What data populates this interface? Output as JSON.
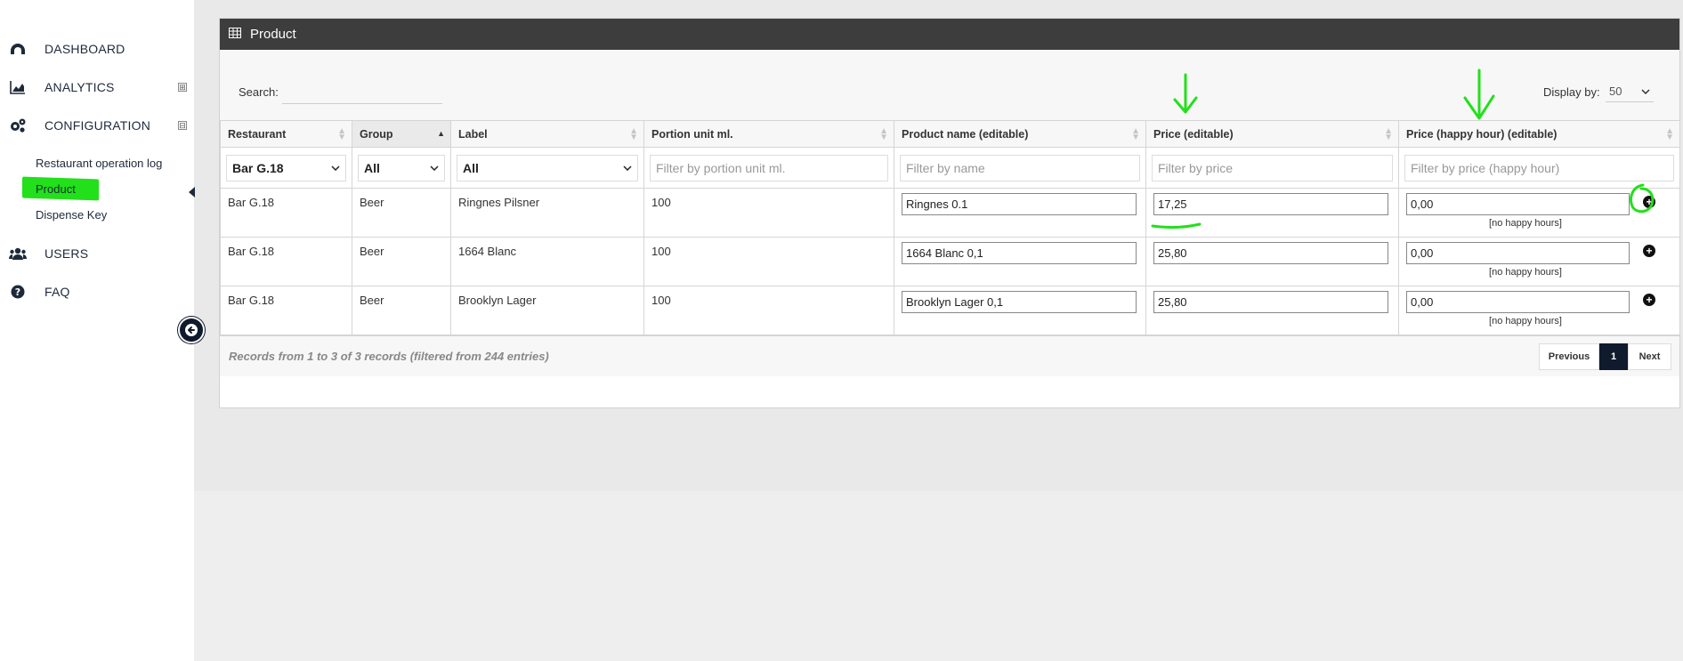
{
  "sidebar": {
    "items": [
      {
        "label": "DASHBOARD",
        "icon": "dashboard-icon"
      },
      {
        "label": "ANALYTICS",
        "icon": "area-chart-icon",
        "toggle": "⊞"
      },
      {
        "label": "CONFIGURATION",
        "icon": "cogs-icon",
        "toggle": "⊟"
      },
      {
        "label": "USERS",
        "icon": "users-icon"
      },
      {
        "label": "FAQ",
        "icon": "question-circle-icon"
      }
    ],
    "subitems": [
      "Restaurant operation log",
      "Product",
      "Dispense Key"
    ],
    "highlight_color": "#22e01a"
  },
  "panel": {
    "title": "Product",
    "search_label": "Search:",
    "display_label": "Display by:",
    "display_value": "50"
  },
  "table": {
    "columns": [
      "Restaurant",
      "Group",
      "Label",
      "Portion unit ml.",
      "Product name (editable)",
      "Price (editable)",
      "Price (happy hour) (editable)"
    ],
    "filters": {
      "restaurant": "Bar G.18",
      "group": "All",
      "label": "All",
      "portion_placeholder": "Filter by portion unit ml.",
      "name_placeholder": "Filter by name",
      "price_placeholder": "Filter by price",
      "hh_placeholder": "Filter by price (happy hour)"
    },
    "rows": [
      {
        "restaurant": "Bar G.18",
        "group": "Beer",
        "label": "Ringnes Pilsner",
        "portion": "100",
        "name": "Ringnes 0.1",
        "price": "17,25",
        "hh_price": "0,00",
        "hh_note": "[no happy hours]"
      },
      {
        "restaurant": "Bar G.18",
        "group": "Beer",
        "label": "1664 Blanc",
        "portion": "100",
        "name": "1664 Blanc 0,1",
        "price": "25,80",
        "hh_price": "0,00",
        "hh_note": "[no happy hours]"
      },
      {
        "restaurant": "Bar G.18",
        "group": "Beer",
        "label": "Brooklyn Lager",
        "portion": "100",
        "name": "Brooklyn Lager 0,1",
        "price": "25,80",
        "hh_price": "0,00",
        "hh_note": "[no happy hours]"
      }
    ]
  },
  "footer": {
    "records_info": "Records from 1 to 3 of 3 records (filtered from 244 entries)",
    "prev": "Previous",
    "page": "1",
    "next": "Next"
  },
  "colors": {
    "header_bg": "#3d3d3d",
    "nav_dark": "#0f1a2c",
    "annotation": "#22e01a"
  }
}
